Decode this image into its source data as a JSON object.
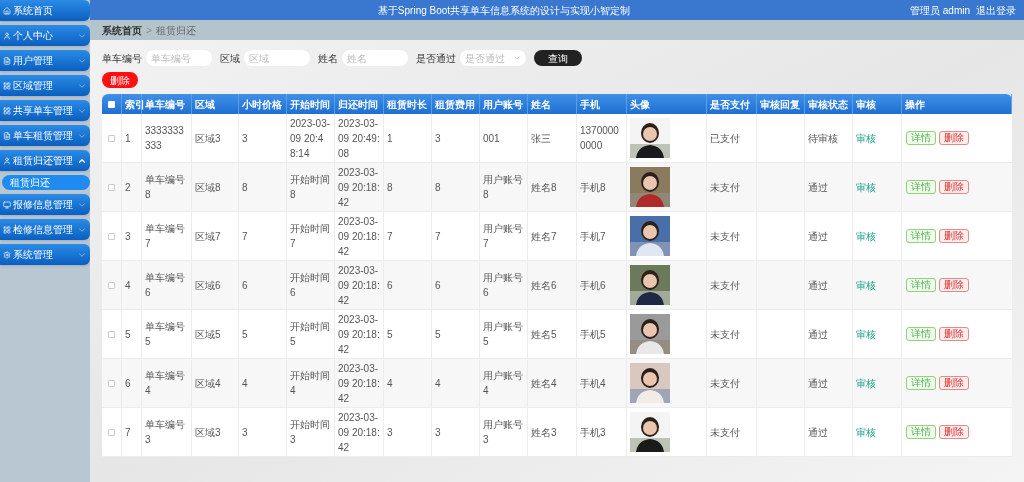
{
  "header": {
    "title": "基于Spring Boot共享单车信息系统的设计与实现小智定制",
    "user": "管理员 admin",
    "logout": "退出登录"
  },
  "sidebar": {
    "items": [
      {
        "label": "系统首页"
      },
      {
        "label": "个人中心",
        "expanded": false
      },
      {
        "label": "用户管理",
        "expanded": false
      },
      {
        "label": "区域管理",
        "expanded": false
      },
      {
        "label": "共享单车管理",
        "expanded": false
      },
      {
        "label": "单车租赁管理",
        "expanded": false
      },
      {
        "label": "租赁归还管理",
        "expanded": true,
        "children": [
          {
            "label": "租赁归还",
            "selected": true
          }
        ]
      },
      {
        "label": "报修信息管理",
        "expanded": false
      },
      {
        "label": "检修信息管理",
        "expanded": false
      },
      {
        "label": "系统管理",
        "expanded": false
      }
    ]
  },
  "breadcrumb": {
    "items": [
      "系统首页",
      "租赁归还"
    ],
    "separator": ">"
  },
  "search": {
    "fields": [
      {
        "label": "单车编号",
        "placeholder": "单车编号",
        "kind": "input"
      },
      {
        "label": "区域",
        "placeholder": "区域",
        "kind": "input"
      },
      {
        "label": "姓名",
        "placeholder": "姓名",
        "kind": "input"
      },
      {
        "label": "是否通过",
        "placeholder": "是否通过",
        "kind": "select"
      }
    ],
    "button": "查询"
  },
  "delete_button": "删除",
  "table": {
    "all_checked": false,
    "columns": [
      "索引",
      "单车编号",
      "区域",
      "小时价格",
      "开始时间",
      "归还时间",
      "租赁时长",
      "租赁费用",
      "用户账号",
      "姓名",
      "手机",
      "头像",
      "是否支付",
      "审核回复",
      "审核状态",
      "审核",
      "操作"
    ],
    "rows": [
      {
        "checked": false,
        "index": "1",
        "bike": "3333333333",
        "area": "区域3",
        "price": "3",
        "start": "2023-03-09 20:48:14",
        "end": "2023-03-09 20:49:08",
        "hours": "1",
        "fee": "3",
        "account": "001",
        "name": "张三",
        "phone": "13700000000",
        "paid": "已支付",
        "status": "待审核",
        "audit": "审核",
        "actions": [
          "详情",
          "删除"
        ]
      },
      {
        "checked": false,
        "index": "2",
        "bike": "单车编号8",
        "area": "区域8",
        "price": "8",
        "start": "开始时间8",
        "end": "2023-03-09 20:18:42",
        "hours": "8",
        "fee": "8",
        "account": "用户账号8",
        "name": "姓名8",
        "phone": "手机8",
        "paid": "未支付",
        "status": "通过",
        "audit": "审核",
        "actions": [
          "详情",
          "删除"
        ]
      },
      {
        "checked": false,
        "index": "3",
        "bike": "单车编号7",
        "area": "区域7",
        "price": "7",
        "start": "开始时间7",
        "end": "2023-03-09 20:18:42",
        "hours": "7",
        "fee": "7",
        "account": "用户账号7",
        "name": "姓名7",
        "phone": "手机7",
        "paid": "未支付",
        "status": "通过",
        "audit": "审核",
        "actions": [
          "详情",
          "删除"
        ]
      },
      {
        "checked": false,
        "index": "4",
        "bike": "单车编号6",
        "area": "区域6",
        "price": "6",
        "start": "开始时间6",
        "end": "2023-03-09 20:18:42",
        "hours": "6",
        "fee": "6",
        "account": "用户账号6",
        "name": "姓名6",
        "phone": "手机6",
        "paid": "未支付",
        "status": "通过",
        "audit": "审核",
        "actions": [
          "详情",
          "删除"
        ]
      },
      {
        "checked": false,
        "index": "5",
        "bike": "单车编号5",
        "area": "区域5",
        "price": "5",
        "start": "开始时间5",
        "end": "2023-03-09 20:18:42",
        "hours": "5",
        "fee": "5",
        "account": "用户账号5",
        "name": "姓名5",
        "phone": "手机5",
        "paid": "未支付",
        "status": "通过",
        "audit": "审核",
        "actions": [
          "详情",
          "删除"
        ]
      },
      {
        "checked": false,
        "index": "6",
        "bike": "单车编号4",
        "area": "区域4",
        "price": "4",
        "start": "开始时间4",
        "end": "2023-03-09 20:18:42",
        "hours": "4",
        "fee": "4",
        "account": "用户账号4",
        "name": "姓名4",
        "phone": "手机4",
        "paid": "未支付",
        "status": "通过",
        "audit": "审核",
        "actions": [
          "详情",
          "删除"
        ]
      },
      {
        "checked": false,
        "index": "7",
        "bike": "单车编号3",
        "area": "区域3",
        "price": "3",
        "start": "开始时间3",
        "end": "2023-03-09 20:18:42",
        "hours": "3",
        "fee": "3",
        "account": "用户账号3",
        "name": "姓名3",
        "phone": "手机3",
        "paid": "未支付",
        "status": "通过",
        "audit": "审核",
        "actions": [
          "详情",
          "删除"
        ]
      }
    ]
  }
}
